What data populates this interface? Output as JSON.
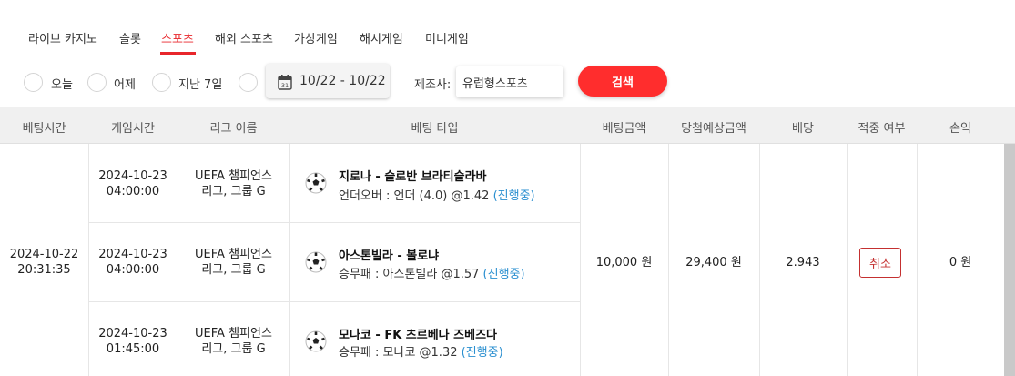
{
  "tabs": [
    {
      "label": "라이브 카지노"
    },
    {
      "label": "슬롯"
    },
    {
      "label": "스포츠"
    },
    {
      "label": "해외 스포츠"
    },
    {
      "label": "가상게임"
    },
    {
      "label": "해시게임"
    },
    {
      "label": "미니게임"
    }
  ],
  "active_tab": "스포츠",
  "filters": {
    "periods": [
      {
        "label": "오늘"
      },
      {
        "label": "어제"
      },
      {
        "label": "지난 7일"
      }
    ],
    "date_range": "10/22 - 10/22",
    "provider_label": "제조사:",
    "provider_value": "유럽형스포츠",
    "search_label": "검색"
  },
  "columns": [
    "베팅시간",
    "게임시간",
    "리그 이름",
    "베팅 타입",
    "베팅금액",
    "당첨예상금액",
    "배당",
    "적중 여부",
    "손익"
  ],
  "bet": {
    "bet_time_date": "2024-10-22",
    "bet_time_clock": "20:31:35",
    "amount": "10,000 원",
    "expected_win": "29,400 원",
    "odds": "2.943",
    "result_button": "취소",
    "profit": "0 원",
    "selections": [
      {
        "game_date": "2024-10-23",
        "game_clock": "04:00:00",
        "league_line1": "UEFA 챔피언스",
        "league_line2": "리그, 그룹 G",
        "match": "지로나 - 슬로반 브라티슬라바",
        "bet_type": "언더오버 : 언더 (4.0) @1.42",
        "status": "(진행중)"
      },
      {
        "game_date": "2024-10-23",
        "game_clock": "04:00:00",
        "league_line1": "UEFA 챔피언스",
        "league_line2": "리그, 그룹 G",
        "match": "아스톤빌라 - 볼로냐",
        "bet_type": "승무패 : 아스톤빌라 @1.57",
        "status": "(진행중)"
      },
      {
        "game_date": "2024-10-23",
        "game_clock": "01:45:00",
        "league_line1": "UEFA 챔피언스",
        "league_line2": "리그, 그룹 G",
        "match": "모나코 - FK 츠르베나 즈베즈다",
        "bet_type": "승무패 : 모나코 @1.32",
        "status": "(진행중)"
      }
    ]
  },
  "colors": {
    "accent": "#e8262b",
    "search_button": "#ff2d2d",
    "status_text": "#2a8fd0",
    "header_bg": "#f0f0f0"
  },
  "icons": {
    "date": "calendar-icon",
    "sport": "soccer-ball-icon"
  }
}
